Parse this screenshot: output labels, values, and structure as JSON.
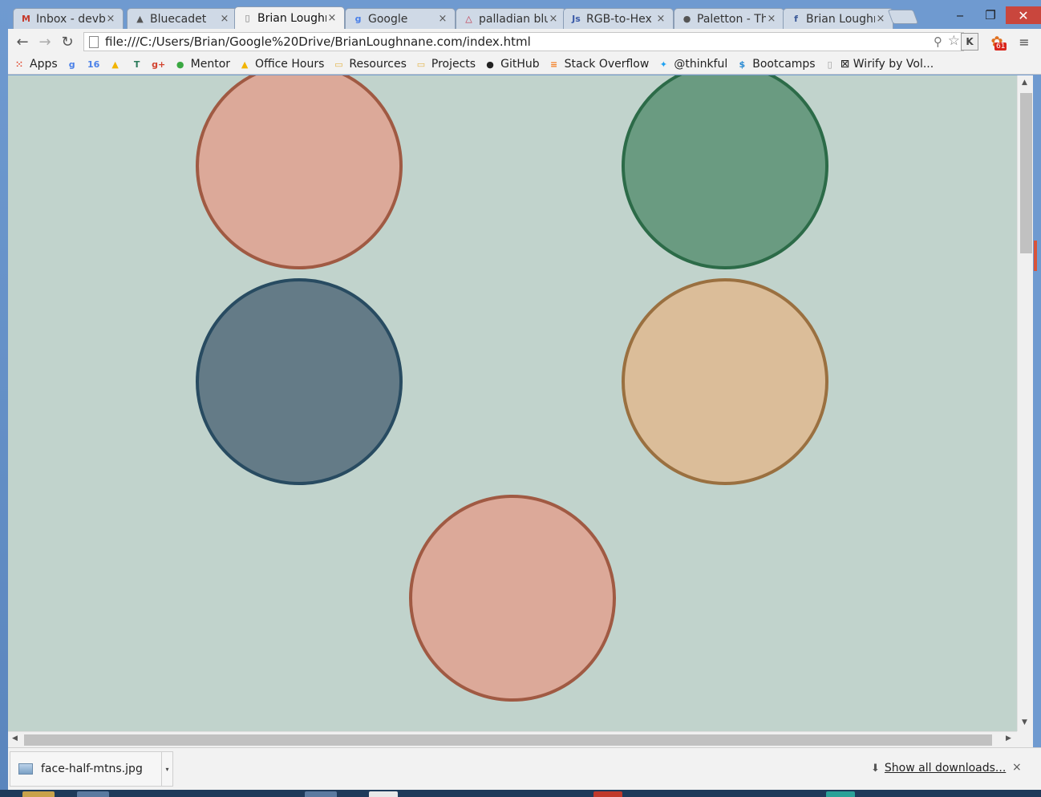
{
  "tabs": [
    {
      "title": "Inbox - devb",
      "favicon": "gmail-icon",
      "glyph": "M",
      "color": "#c5392b",
      "active": false
    },
    {
      "title": "Bluecadet",
      "favicon": "bluecadet-icon",
      "glyph": "▲",
      "color": "#555555",
      "active": false
    },
    {
      "title": "Brian Loughn",
      "favicon": "page-icon",
      "glyph": "▯",
      "color": "#777777",
      "active": true
    },
    {
      "title": "Google",
      "favicon": "google-icon",
      "glyph": "g",
      "color": "#4a80e8",
      "active": false
    },
    {
      "title": "palladian blu",
      "favicon": "warning-icon",
      "glyph": "△",
      "color": "#c0354a",
      "active": false
    },
    {
      "title": "RGB-to-Hex",
      "favicon": "js-icon",
      "glyph": "Js",
      "color": "#3a5aa8",
      "active": false
    },
    {
      "title": "Paletton - Th",
      "favicon": "paletton-icon",
      "glyph": "●",
      "color": "#555555",
      "active": false
    },
    {
      "title": "Brian Loughn",
      "favicon": "facebook-icon",
      "glyph": "f",
      "color": "#3b5998",
      "active": false
    }
  ],
  "tab_close_glyph": "×",
  "window_controls": {
    "minimize": "‒",
    "maximize": "❐",
    "close": "✕"
  },
  "toolbar": {
    "back": "←",
    "forward": "→",
    "reload": "↻",
    "url": "file:///C:/Users/Brian/Google%20Drive/BrianLoughnane.com/index.html",
    "zoom_glyph": "⚲",
    "star_glyph": "☆",
    "ext_k": "K",
    "ext_badge_glyph": "✿",
    "ext_badge_count": "61",
    "menu_glyph": "≡"
  },
  "bookmarks": [
    {
      "label": "Apps",
      "icon": "apps-grid-icon",
      "glyph": "⁙",
      "color": "#e0452a"
    },
    {
      "label": "",
      "icon": "google-icon",
      "glyph": "g",
      "color": "#4a80e8"
    },
    {
      "label": "",
      "icon": "calendar-icon",
      "glyph": "16",
      "color": "#4a80e8"
    },
    {
      "label": "",
      "icon": "drive-icon",
      "glyph": "▲",
      "color": "#f2b400"
    },
    {
      "label": "",
      "icon": "trello-icon",
      "glyph": "T",
      "color": "#2a7a5a"
    },
    {
      "label": "",
      "icon": "google-plus-icon",
      "glyph": "g+",
      "color": "#d2432f"
    },
    {
      "label": "Mentor",
      "icon": "mentor-icon",
      "glyph": "●",
      "color": "#3aa842"
    },
    {
      "label": "Office Hours",
      "icon": "drive-icon",
      "glyph": "▲",
      "color": "#f2b400"
    },
    {
      "label": "Resources",
      "icon": "folder-icon",
      "glyph": "▭",
      "color": "#e2b44a"
    },
    {
      "label": "Projects",
      "icon": "folder-icon",
      "glyph": "▭",
      "color": "#e2b44a"
    },
    {
      "label": "GitHub",
      "icon": "github-icon",
      "glyph": "●",
      "color": "#222222"
    },
    {
      "label": "Stack Overflow",
      "icon": "stackoverflow-icon",
      "glyph": "≡",
      "color": "#f48024"
    },
    {
      "label": "@thinkful",
      "icon": "twitter-icon",
      "glyph": "✦",
      "color": "#1da1f2"
    },
    {
      "label": "Bootcamps",
      "icon": "bootcamps-icon",
      "glyph": "$",
      "color": "#2a8ad2"
    },
    {
      "label": "⊠ Wirify by Vol...",
      "icon": "page-icon",
      "glyph": "▯",
      "color": "#999999"
    }
  ],
  "page": {
    "background": "#c1d3cc",
    "circles": [
      {
        "name": "salmon-circle-top-left",
        "fill": "#dca999",
        "stroke": "#a05a43"
      },
      {
        "name": "green-circle-top-right",
        "fill": "#6a9b81",
        "stroke": "#2c6b48"
      },
      {
        "name": "slate-circle-middle-left",
        "fill": "#647b87",
        "stroke": "#284b61"
      },
      {
        "name": "tan-circle-middle-right",
        "fill": "#dbbd99",
        "stroke": "#9a7040"
      },
      {
        "name": "salmon-circle-bottom-center",
        "fill": "#dca999",
        "stroke": "#a05a43"
      }
    ]
  },
  "downloads": {
    "file_name": "face-half-mtns.jpg",
    "dropdown_glyph": "▾",
    "show_all_label": "Show all downloads...",
    "show_all_glyph": "⬇",
    "close_glyph": "×"
  },
  "scrollbar": {
    "up": "▲",
    "down": "▼",
    "left": "◀",
    "right": "▶"
  }
}
